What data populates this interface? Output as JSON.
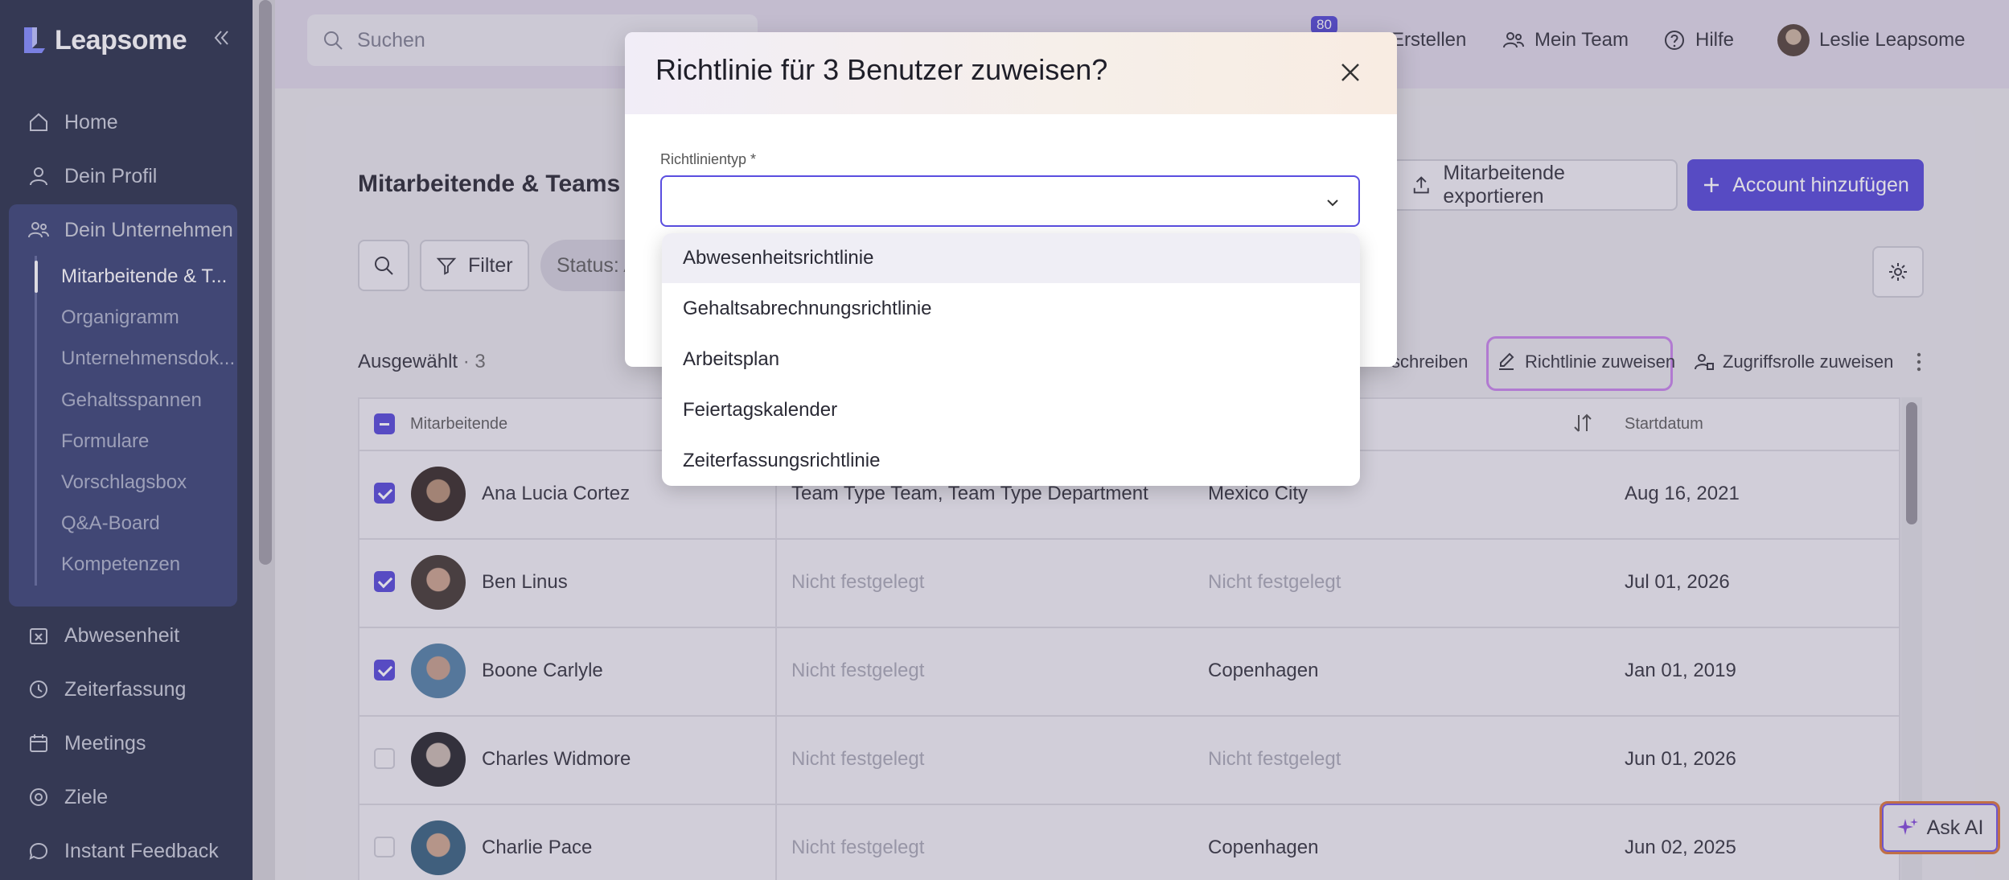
{
  "app": {
    "logo_text": "Leapsome"
  },
  "sidebar": {
    "items": [
      {
        "label": "Home",
        "icon": "home-icon"
      },
      {
        "label": "Dein Profil",
        "icon": "user-icon"
      },
      {
        "label": "Dein Unternehmen",
        "icon": "users-icon"
      },
      {
        "label": "Abwesenheit",
        "icon": "calendar-x-icon"
      },
      {
        "label": "Zeiterfassung",
        "icon": "clock-icon"
      },
      {
        "label": "Meetings",
        "icon": "calendar-icon"
      },
      {
        "label": "Ziele",
        "icon": "target-icon"
      },
      {
        "label": "Instant Feedback",
        "icon": "chat-icon"
      }
    ],
    "company_sub": [
      "Mitarbeitende & T...",
      "Organigramm",
      "Unternehmensdok...",
      "Gehaltsspannen",
      "Formulare",
      "Vorschlagsbox",
      "Q&A-Board",
      "Kompetenzen"
    ]
  },
  "topbar": {
    "search_placeholder": "Suchen",
    "badge": "80",
    "create": "Erstellen",
    "my_team": "Mein Team",
    "help": "Hilfe",
    "user": "Leslie Leapsome"
  },
  "page": {
    "title": "Mitarbeitende & Teams",
    "export_label": "Mitarbeitende exportieren",
    "add_label": "Account hinzufügen",
    "filter_label": "Filter",
    "status_chip": "Status: A",
    "selected_label": "Ausgewählt",
    "selected_count": "· 3",
    "action_partial": "schreiben",
    "assign_policy": "Richtlinie zuweisen",
    "assign_role": "Zugriffsrolle zuweisen"
  },
  "table": {
    "col_employee": "Mitarbeitende",
    "col_startdate": "Startdatum",
    "rows": [
      {
        "name": "Ana Lucia Cortez",
        "team": "Team Type Team, Team Type Department",
        "location": "Mexico City",
        "start": "Aug 16, 2021",
        "checked": true
      },
      {
        "name": "Ben Linus",
        "team": "Nicht festgelegt",
        "location": "Nicht festgelegt",
        "start": "Jul 01, 2026",
        "checked": true
      },
      {
        "name": "Boone Carlyle",
        "team": "Nicht festgelegt",
        "location": "Copenhagen",
        "start": "Jan 01, 2019",
        "checked": true
      },
      {
        "name": "Charles Widmore",
        "team": "Nicht festgelegt",
        "location": "Nicht festgelegt",
        "start": "Jun 01, 2026",
        "checked": false
      },
      {
        "name": "Charlie Pace",
        "team": "Nicht festgelegt",
        "location": "Copenhagen",
        "start": "Jun 02, 2025",
        "checked": false
      }
    ]
  },
  "modal": {
    "title": "Richtlinie für 3 Benutzer zuweisen?",
    "field_label": "Richtlinientyp *",
    "select_value": "",
    "options": [
      "Abwesenheitsrichtlinie",
      "Gehaltsabrechnungsrichtlinie",
      "Arbeitsplan",
      "Feiertagskalender",
      "Zeiterfassungsrichtlinie"
    ]
  },
  "ask_ai": {
    "label": "Ask AI"
  },
  "colors": {
    "sidebar_bg": "#1f2742",
    "accent": "#4d3fd6",
    "highlight": "#c47ee8"
  }
}
